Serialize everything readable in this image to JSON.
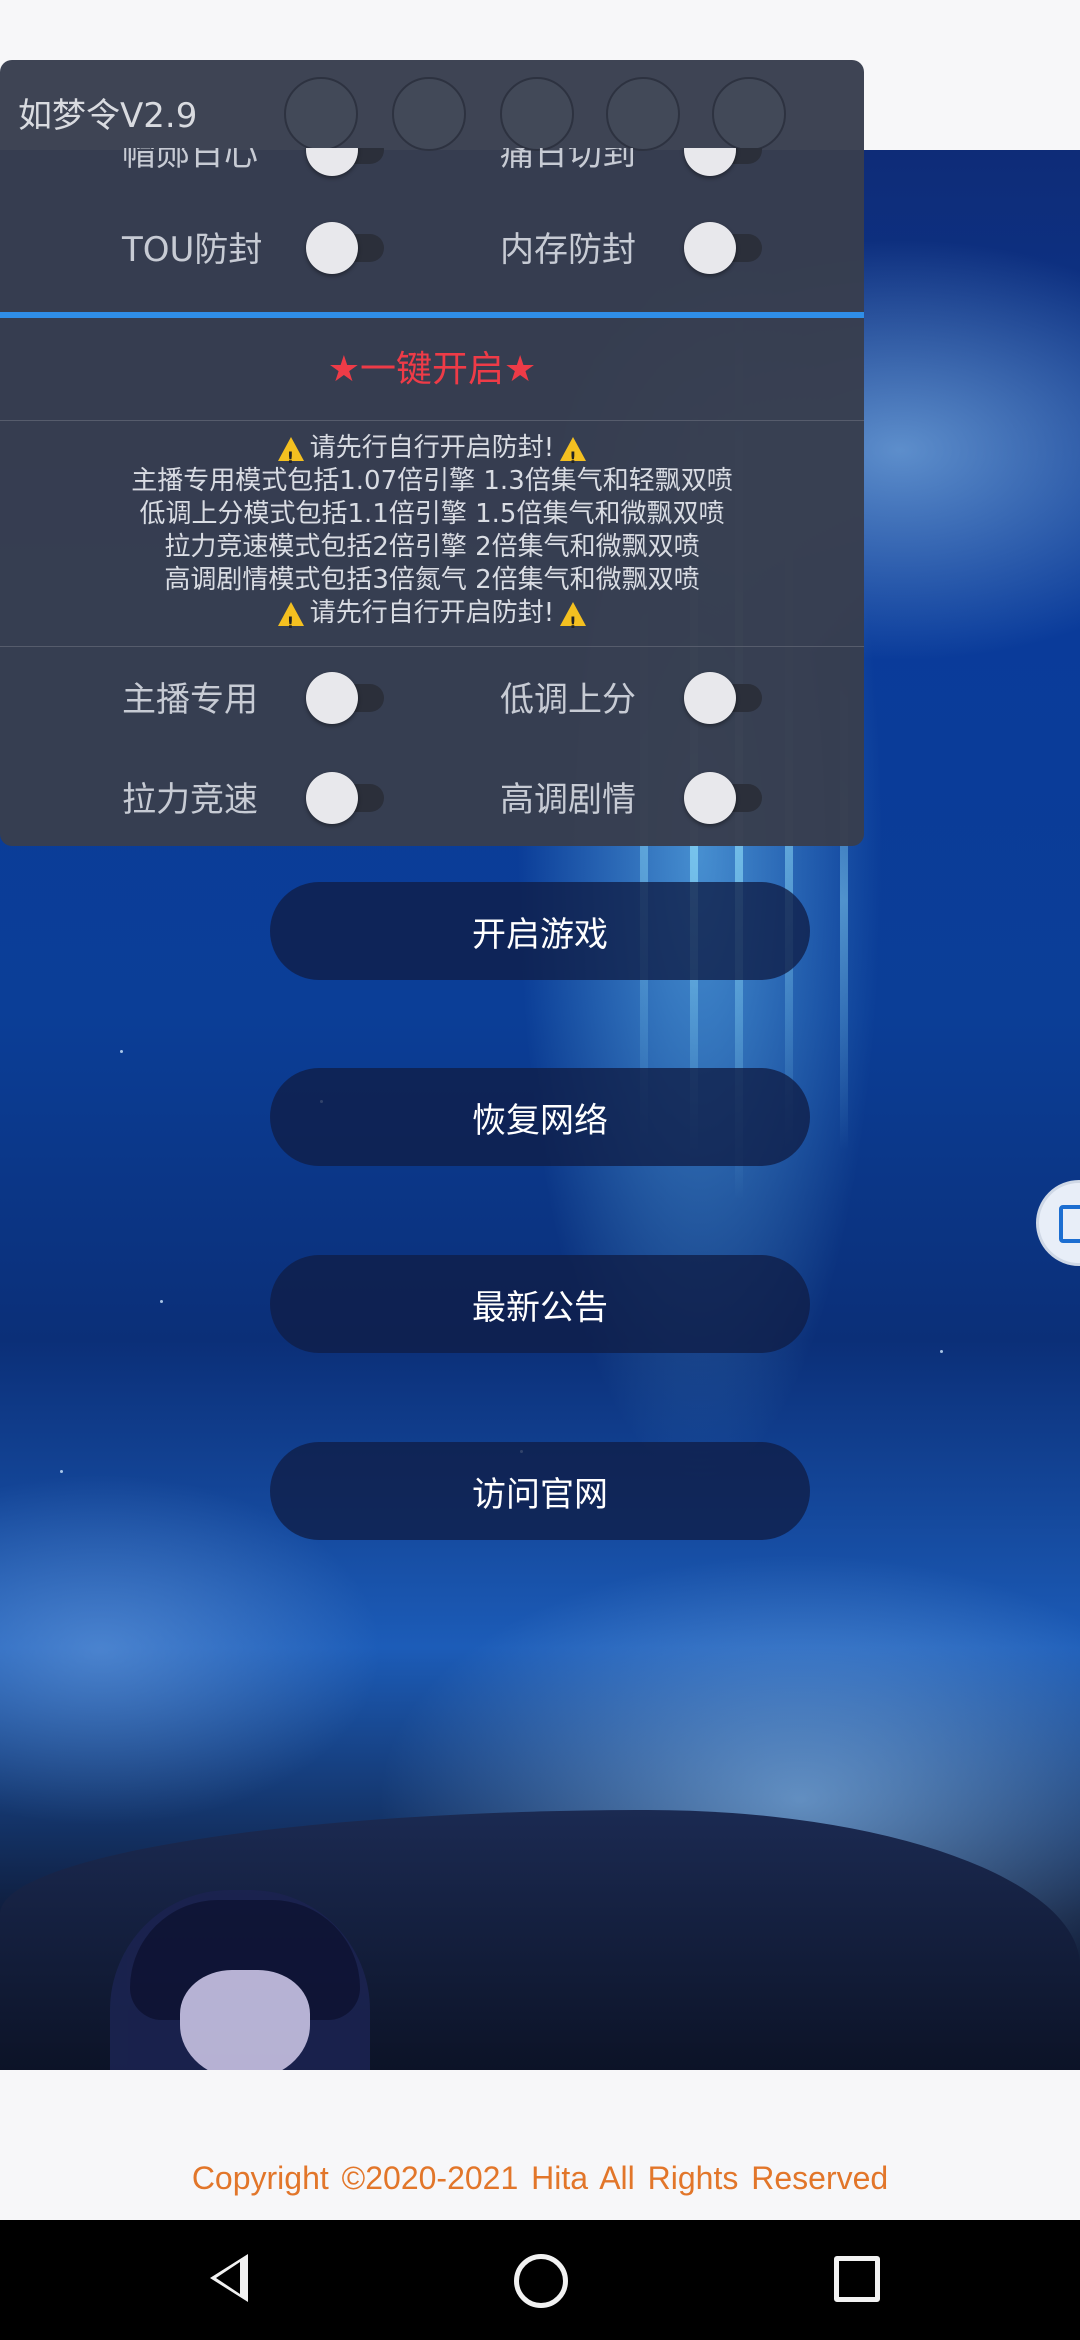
{
  "panel": {
    "title": "如梦令V2.9",
    "cut_row": {
      "left_label": "帽郧日心",
      "right_label": "痛日切到"
    },
    "row1": {
      "left_label": "TOU防封",
      "right_label": "内存防封"
    },
    "onekey_label": "★一键开启★",
    "notes": [
      "请先行自行开启防封!",
      "主播专用模式包括1.07倍引擎 1.3倍集气和轻飘双喷",
      "低调上分模式包括1.1倍引擎 1.5倍集气和微飘双喷",
      "拉力竞速模式包括2倍引擎 2倍集气和微飘双喷",
      "高调剧情模式包括3倍氮气 2倍集气和微飘双喷",
      "请先行自行开启防封!"
    ],
    "row2": {
      "left_label": "主播专用",
      "right_label": "低调上分"
    },
    "row3": {
      "left_label": "拉力竞速",
      "right_label": "高调剧情"
    }
  },
  "buttons": {
    "start_game": "开启游戏",
    "restore_network": "恢复网络",
    "latest_notice": "最新公告",
    "visit_site": "访问官网"
  },
  "footer": {
    "copyright": "Copyright ©2020-2021 Hita    All Rights Reserved"
  },
  "icons": [
    "warning-icon",
    "back-icon",
    "home-icon",
    "recent-apps-icon",
    "floating-cube-icon"
  ]
}
